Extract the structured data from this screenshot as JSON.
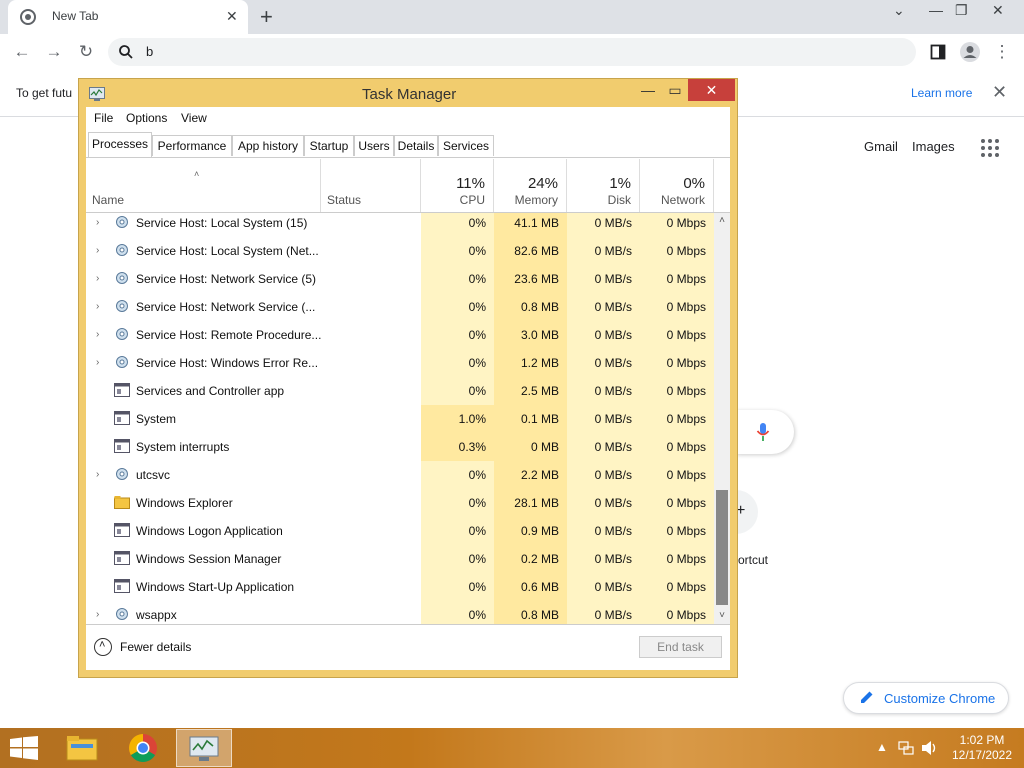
{
  "browser": {
    "tab_title": "New Tab",
    "address_value": "b",
    "infobar_text": "To get futu",
    "learn_more": "Learn more",
    "links": [
      "Gmail",
      "Images"
    ],
    "shortcut_label": "ortcut",
    "customize_label": "Customize Chrome",
    "colors": {
      "link": "#1a73e8",
      "tabstrip": "#dee1e6"
    }
  },
  "task_manager": {
    "title": "Task Manager",
    "menus": [
      "File",
      "Options",
      "View"
    ],
    "tabs": [
      "Processes",
      "Performance",
      "App history",
      "Startup",
      "Users",
      "Details",
      "Services"
    ],
    "active_tab": "Processes",
    "columns": {
      "name": "Name",
      "status": "Status",
      "cpu": {
        "label": "CPU",
        "pct": "11%"
      },
      "memory": {
        "label": "Memory",
        "pct": "24%"
      },
      "disk": {
        "label": "Disk",
        "pct": "1%"
      },
      "network": {
        "label": "Network",
        "pct": "0%"
      }
    },
    "processes": [
      {
        "name": "Service Host: Local System (15)",
        "icon": "gear-icon",
        "expandable": true,
        "cpu": "0%",
        "memory": "41.1 MB",
        "disk": "0 MB/s",
        "network": "0 Mbps"
      },
      {
        "name": "Service Host: Local System (Net...",
        "icon": "gear-icon",
        "expandable": true,
        "cpu": "0%",
        "memory": "82.6 MB",
        "disk": "0 MB/s",
        "network": "0 Mbps"
      },
      {
        "name": "Service Host: Network Service (5)",
        "icon": "gear-icon",
        "expandable": true,
        "cpu": "0%",
        "memory": "23.6 MB",
        "disk": "0 MB/s",
        "network": "0 Mbps"
      },
      {
        "name": "Service Host: Network Service (...",
        "icon": "gear-icon",
        "expandable": true,
        "cpu": "0%",
        "memory": "0.8 MB",
        "disk": "0 MB/s",
        "network": "0 Mbps"
      },
      {
        "name": "Service Host: Remote Procedure...",
        "icon": "gear-icon",
        "expandable": true,
        "cpu": "0%",
        "memory": "3.0 MB",
        "disk": "0 MB/s",
        "network": "0 Mbps"
      },
      {
        "name": "Service Host: Windows Error Re...",
        "icon": "gear-icon",
        "expandable": true,
        "cpu": "0%",
        "memory": "1.2 MB",
        "disk": "0 MB/s",
        "network": "0 Mbps"
      },
      {
        "name": "Services and Controller app",
        "icon": "window-icon",
        "expandable": false,
        "cpu": "0%",
        "memory": "2.5 MB",
        "disk": "0 MB/s",
        "network": "0 Mbps"
      },
      {
        "name": "System",
        "icon": "window-icon",
        "expandable": false,
        "cpu": "1.0%",
        "memory": "0.1 MB",
        "disk": "0 MB/s",
        "network": "0 Mbps"
      },
      {
        "name": "System interrupts",
        "icon": "window-icon",
        "expandable": false,
        "cpu": "0.3%",
        "memory": "0 MB",
        "disk": "0 MB/s",
        "network": "0 Mbps"
      },
      {
        "name": "utcsvc",
        "icon": "gear-icon",
        "expandable": true,
        "cpu": "0%",
        "memory": "2.2 MB",
        "disk": "0 MB/s",
        "network": "0 Mbps"
      },
      {
        "name": "Windows Explorer",
        "icon": "folder-icon",
        "expandable": false,
        "cpu": "0%",
        "memory": "28.1 MB",
        "disk": "0 MB/s",
        "network": "0 Mbps"
      },
      {
        "name": "Windows Logon Application",
        "icon": "window-icon",
        "expandable": false,
        "cpu": "0%",
        "memory": "0.9 MB",
        "disk": "0 MB/s",
        "network": "0 Mbps"
      },
      {
        "name": "Windows Session Manager",
        "icon": "window-icon",
        "expandable": false,
        "cpu": "0%",
        "memory": "0.2 MB",
        "disk": "0 MB/s",
        "network": "0 Mbps"
      },
      {
        "name": "Windows Start-Up Application",
        "icon": "window-icon",
        "expandable": false,
        "cpu": "0%",
        "memory": "0.6 MB",
        "disk": "0 MB/s",
        "network": "0 Mbps"
      },
      {
        "name": "wsappx",
        "icon": "gear-icon",
        "expandable": true,
        "cpu": "0%",
        "memory": "0.8 MB",
        "disk": "0 MB/s",
        "network": "0 Mbps"
      }
    ],
    "fewer_details": "Fewer details",
    "end_task": "End task",
    "colors": {
      "frame": "#f1cc6e",
      "close": "#c7403b",
      "heat_light": "#fff4c4",
      "heat_mid": "#ffe9a0"
    }
  },
  "taskbar": {
    "time": "1:02 PM",
    "date": "12/17/2022",
    "apps": [
      "file-explorer-icon",
      "chrome-icon",
      "task-manager-icon"
    ]
  }
}
